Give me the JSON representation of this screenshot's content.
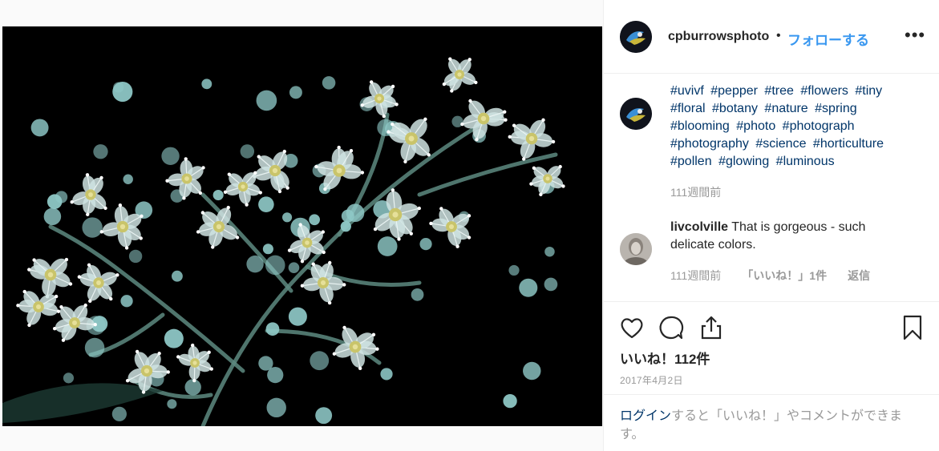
{
  "post": {
    "username": "cpburrowsphoto",
    "dot": "•",
    "follow_label": "フォローする",
    "more_label": "•••"
  },
  "caption": {
    "hashtags": [
      "#uvivf",
      "#pepper",
      "#tree",
      "#flowers",
      "#tiny",
      "#floral",
      "#botany",
      "#nature",
      "#spring",
      "#blooming",
      "#photo",
      "#photograph",
      "#photography",
      "#science",
      "#horticulture",
      "#pollen",
      "#glowing",
      "#luminous"
    ],
    "time": "111週間前"
  },
  "comment": {
    "username": "livcolville",
    "text": "That is gorgeous - such delicate colors.",
    "time": "111週間前",
    "likes": "「いいね！」1件",
    "reply": "返信"
  },
  "actions": {
    "like_icon": "heart-icon",
    "comment_icon": "comment-icon",
    "share_icon": "share-icon",
    "save_icon": "bookmark-icon",
    "likes_label": "いいね！112件",
    "date": "2017年4月2日"
  },
  "login": {
    "link_label": "ログイン",
    "rest_text": "すると「いいね！」やコメントができます。"
  },
  "colors": {
    "link_blue": "#3897f0",
    "hashtag": "#003569",
    "muted": "#999999"
  }
}
